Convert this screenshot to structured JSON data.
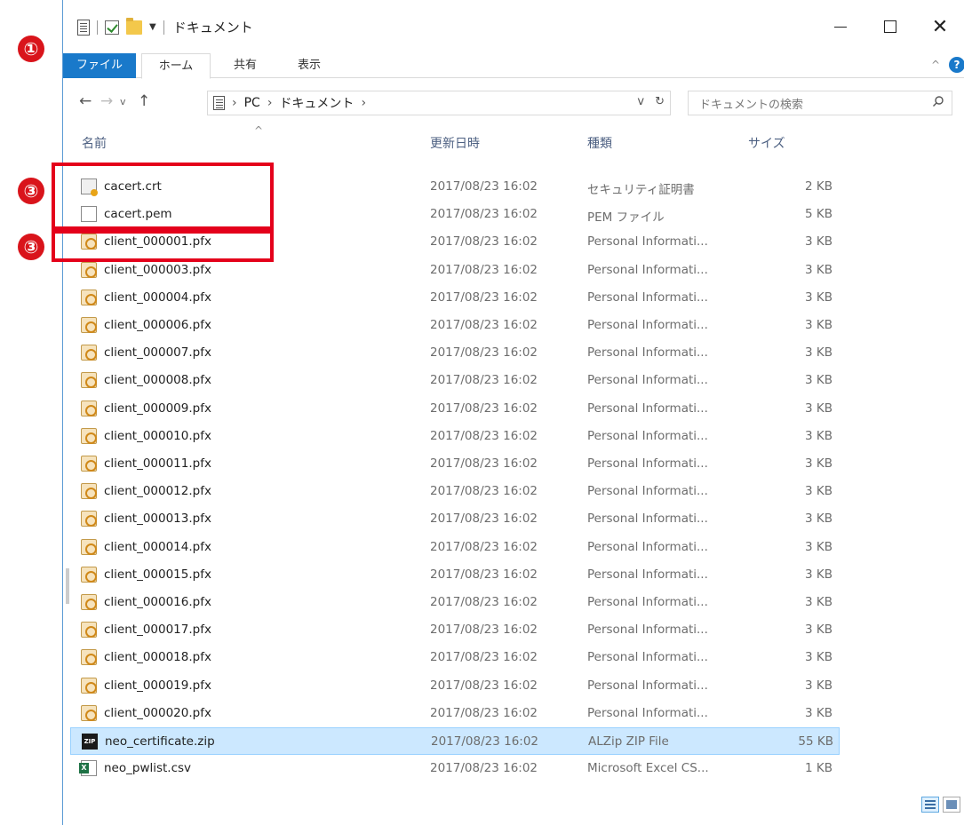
{
  "window": {
    "title": "ドキュメント",
    "controls": {
      "minimize": "—",
      "maximize": "□",
      "close": "✕"
    }
  },
  "ribbon": {
    "tabs": [
      "ファイル",
      "ホーム",
      "共有",
      "表示"
    ],
    "help": "?",
    "collapse": "^"
  },
  "navigation": {
    "back": "←",
    "forward": "→",
    "recent": "v",
    "up": "↑",
    "breadcrumb": [
      "PC",
      "ドキュメント"
    ],
    "refresh": "↻",
    "dropdown": "v"
  },
  "search": {
    "placeholder": "ドキュメントの検索"
  },
  "columns": {
    "name": "名前",
    "date": "更新日時",
    "type": "種類",
    "size": "サイズ"
  },
  "files": [
    {
      "name": "cacert.crt",
      "date": "2017/08/23 16:02",
      "type": "セキュリティ証明書",
      "size": "2 KB",
      "icon": "certificate-icon"
    },
    {
      "name": "cacert.pem",
      "date": "2017/08/23 16:02",
      "type": "PEM ファイル",
      "size": "5 KB",
      "icon": "document-icon"
    },
    {
      "name": "client_000001.pfx",
      "date": "2017/08/23 16:02",
      "type": "Personal Informati...",
      "size": "3 KB",
      "icon": "pfx-icon"
    },
    {
      "name": "client_000003.pfx",
      "date": "2017/08/23 16:02",
      "type": "Personal Informati...",
      "size": "3 KB",
      "icon": "pfx-icon"
    },
    {
      "name": "client_000004.pfx",
      "date": "2017/08/23 16:02",
      "type": "Personal Informati...",
      "size": "3 KB",
      "icon": "pfx-icon"
    },
    {
      "name": "client_000006.pfx",
      "date": "2017/08/23 16:02",
      "type": "Personal Informati...",
      "size": "3 KB",
      "icon": "pfx-icon"
    },
    {
      "name": "client_000007.pfx",
      "date": "2017/08/23 16:02",
      "type": "Personal Informati...",
      "size": "3 KB",
      "icon": "pfx-icon"
    },
    {
      "name": "client_000008.pfx",
      "date": "2017/08/23 16:02",
      "type": "Personal Informati...",
      "size": "3 KB",
      "icon": "pfx-icon"
    },
    {
      "name": "client_000009.pfx",
      "date": "2017/08/23 16:02",
      "type": "Personal Informati...",
      "size": "3 KB",
      "icon": "pfx-icon"
    },
    {
      "name": "client_000010.pfx",
      "date": "2017/08/23 16:02",
      "type": "Personal Informati...",
      "size": "3 KB",
      "icon": "pfx-icon"
    },
    {
      "name": "client_000011.pfx",
      "date": "2017/08/23 16:02",
      "type": "Personal Informati...",
      "size": "3 KB",
      "icon": "pfx-icon"
    },
    {
      "name": "client_000012.pfx",
      "date": "2017/08/23 16:02",
      "type": "Personal Informati...",
      "size": "3 KB",
      "icon": "pfx-icon"
    },
    {
      "name": "client_000013.pfx",
      "date": "2017/08/23 16:02",
      "type": "Personal Informati...",
      "size": "3 KB",
      "icon": "pfx-icon"
    },
    {
      "name": "client_000014.pfx",
      "date": "2017/08/23 16:02",
      "type": "Personal Informati...",
      "size": "3 KB",
      "icon": "pfx-icon"
    },
    {
      "name": "client_000015.pfx",
      "date": "2017/08/23 16:02",
      "type": "Personal Informati...",
      "size": "3 KB",
      "icon": "pfx-icon"
    },
    {
      "name": "client_000016.pfx",
      "date": "2017/08/23 16:02",
      "type": "Personal Informati...",
      "size": "3 KB",
      "icon": "pfx-icon"
    },
    {
      "name": "client_000017.pfx",
      "date": "2017/08/23 16:02",
      "type": "Personal Informati...",
      "size": "3 KB",
      "icon": "pfx-icon"
    },
    {
      "name": "client_000018.pfx",
      "date": "2017/08/23 16:02",
      "type": "Personal Informati...",
      "size": "3 KB",
      "icon": "pfx-icon"
    },
    {
      "name": "client_000019.pfx",
      "date": "2017/08/23 16:02",
      "type": "Personal Informati...",
      "size": "3 KB",
      "icon": "pfx-icon"
    },
    {
      "name": "client_000020.pfx",
      "date": "2017/08/23 16:02",
      "type": "Personal Informati...",
      "size": "3 KB",
      "icon": "pfx-icon"
    },
    {
      "name": "neo_certificate.zip",
      "date": "2017/08/23 16:02",
      "type": "ALZip ZIP File",
      "size": "55 KB",
      "icon": "zip-icon",
      "selected": true
    },
    {
      "name": "neo_pwlist.csv",
      "date": "2017/08/23 16:02",
      "type": "Microsoft Excel CS...",
      "size": "1 KB",
      "icon": "excel-csv-icon"
    }
  ],
  "annotations": {
    "marker1": "①",
    "marker3": "③"
  },
  "colors": {
    "accent": "#1979ca",
    "selection": "#cce8ff",
    "annotation": "#e4001b"
  }
}
